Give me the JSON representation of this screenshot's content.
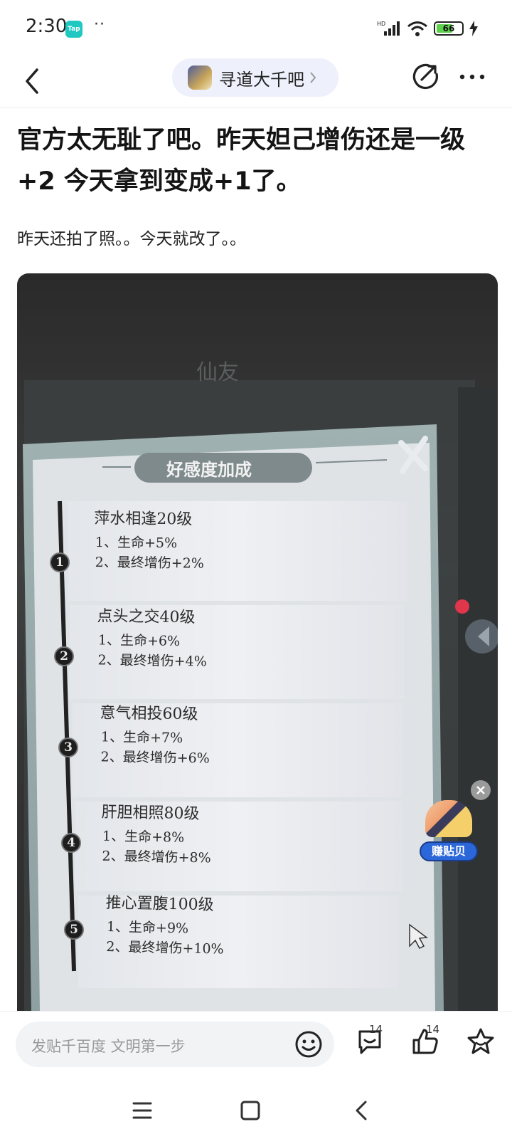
{
  "status_bar": {
    "time": "2:30",
    "app_badge": "Tap",
    "more_indicator": "··",
    "network_label": "HD",
    "battery_level": "66",
    "battery_fraction": 0.66
  },
  "header": {
    "forum_name": "寻道大千吧"
  },
  "post": {
    "title": "官方太无耻了吧。昨天妲己增伤还是一级+2 今天拿到变成+1了。",
    "body": "昨天还拍了照。。今天就改了。。"
  },
  "photo": {
    "faded_caption": "仙友",
    "dialog_title": "好感度加成",
    "tiers": [
      {
        "number": "1",
        "name": "萍水相逢20级",
        "line1": "1、生命+5%",
        "line2": "2、最终增伤+2%"
      },
      {
        "number": "2",
        "name": "点头之交40级",
        "line1": "1、生命+6%",
        "line2": "2、最终增伤+4%"
      },
      {
        "number": "3",
        "name": "意气相投60级",
        "line1": "1、生命+7%",
        "line2": "2、最终增伤+6%"
      },
      {
        "number": "4",
        "name": "肝胆相照80级",
        "line1": "1、生命+8%",
        "line2": "2、最终增伤+8%"
      },
      {
        "number": "5",
        "name": "推心置腹100级",
        "line1": "1、生命+9%",
        "line2": "2、最终增伤+10%"
      }
    ]
  },
  "float_badge": {
    "label": "赚贴贝"
  },
  "bottom_bar": {
    "comment_placeholder": "发贴千百度 文明第一步",
    "reply_count": "14",
    "like_count": "14"
  },
  "colors": {
    "accent_pill": "#eef1fc",
    "battery_green": "#5dd14b",
    "badge_blue": "#2b67d8",
    "dialog_paper": "#eceef1"
  }
}
